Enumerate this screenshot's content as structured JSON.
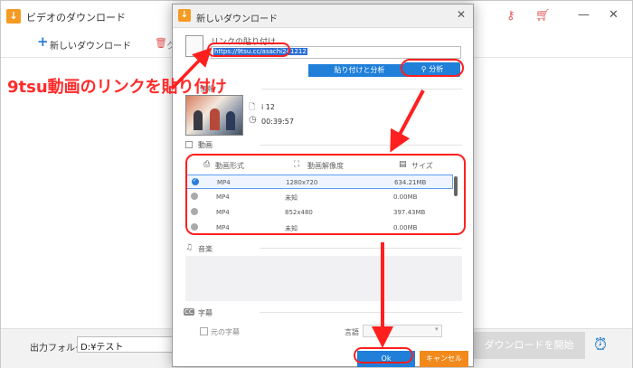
{
  "main_window": {
    "title": "ビデオのダウンロード",
    "toolbar": {
      "new_download_label": "新しいダウンロード",
      "delete_label": "ク"
    },
    "output_folder_label": "出力フォルダ：",
    "output_folder_value": "D:¥テスト",
    "start_download_label": "ダウンロードを開始"
  },
  "dialog": {
    "title": "新しいダウンロード",
    "link_label": "リンクの貼り付け",
    "url_value": "https://9tsu.cc/asachi241212",
    "paste_analyze_label": "貼り付けと分析",
    "analyze_label": "分析",
    "info_label": "情報",
    "video_name": "i 12",
    "duration": "00:39:57",
    "video_section_label": "動画",
    "table": {
      "headers": [
        "動画形式",
        "動画解像度",
        "サイズ"
      ],
      "rows": [
        {
          "format": "MP4",
          "resolution": "1280x720",
          "size": "634.21MB",
          "selected": true
        },
        {
          "format": "MP4",
          "resolution": "未知",
          "size": "0.00MB",
          "selected": false
        },
        {
          "format": "MP4",
          "resolution": "852x480",
          "size": "397.43MB",
          "selected": false
        },
        {
          "format": "MP4",
          "resolution": "未知",
          "size": "0.00MB",
          "selected": false
        }
      ]
    },
    "audio_section_label": "音楽",
    "subtitle_section_label": "字幕",
    "cc_icon_text": "CC",
    "original_subtitle_label": "元の字幕",
    "language_label": "言語",
    "ok_label": "Ok",
    "cancel_label": "キャンセル"
  },
  "annotation": {
    "callout_text": "9tsu動画のリンクを貼り付け"
  },
  "colors": {
    "accent_blue": "#1f7fd9",
    "cancel_orange": "#f18a1b",
    "annotation_red": "#ff1f1f"
  }
}
